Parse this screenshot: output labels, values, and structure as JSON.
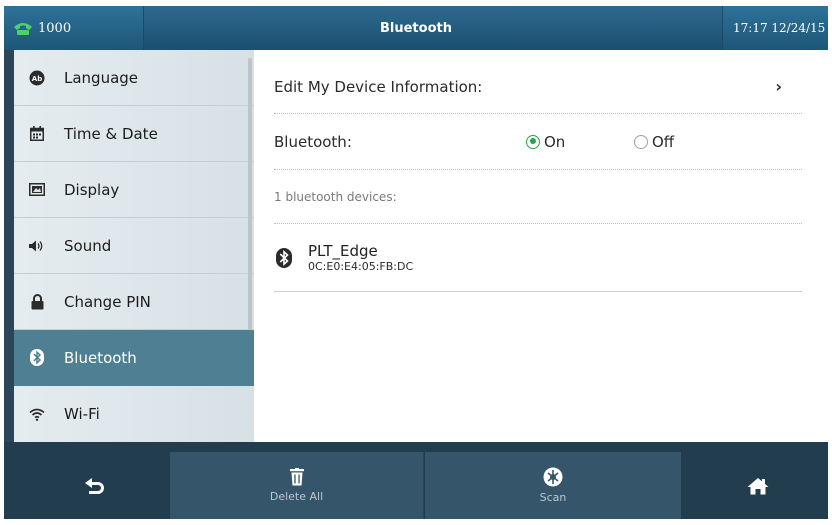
{
  "status_bar": {
    "account": "1000",
    "title": "Bluetooth",
    "clock": "17:17 12/24/15"
  },
  "sidebar": {
    "items": [
      {
        "label": "Language",
        "icon": "language-icon"
      },
      {
        "label": "Time & Date",
        "icon": "calendar-icon"
      },
      {
        "label": "Display",
        "icon": "display-icon"
      },
      {
        "label": "Sound",
        "icon": "speaker-icon"
      },
      {
        "label": "Change PIN",
        "icon": "lock-icon"
      },
      {
        "label": "Bluetooth",
        "icon": "bluetooth-icon",
        "active": true
      },
      {
        "label": "Wi-Fi",
        "icon": "wifi-icon"
      }
    ]
  },
  "main": {
    "edit_label": "Edit My Device Information:",
    "edit_chevron": "›",
    "bluetooth_label": "Bluetooth:",
    "on_label": "On",
    "off_label": "Off",
    "bluetooth_state": "On",
    "device_count_text": "1 bluetooth devices:",
    "devices": [
      {
        "name": "PLT_Edge",
        "mac": "0C:E0:E4:05:FB:DC"
      }
    ]
  },
  "softkeys": {
    "delete_all": "Delete All",
    "scan": "Scan"
  },
  "colors": {
    "accent_green": "#27a34e",
    "active_item": "#4f7f92",
    "status_bar": "#1b4f70"
  }
}
